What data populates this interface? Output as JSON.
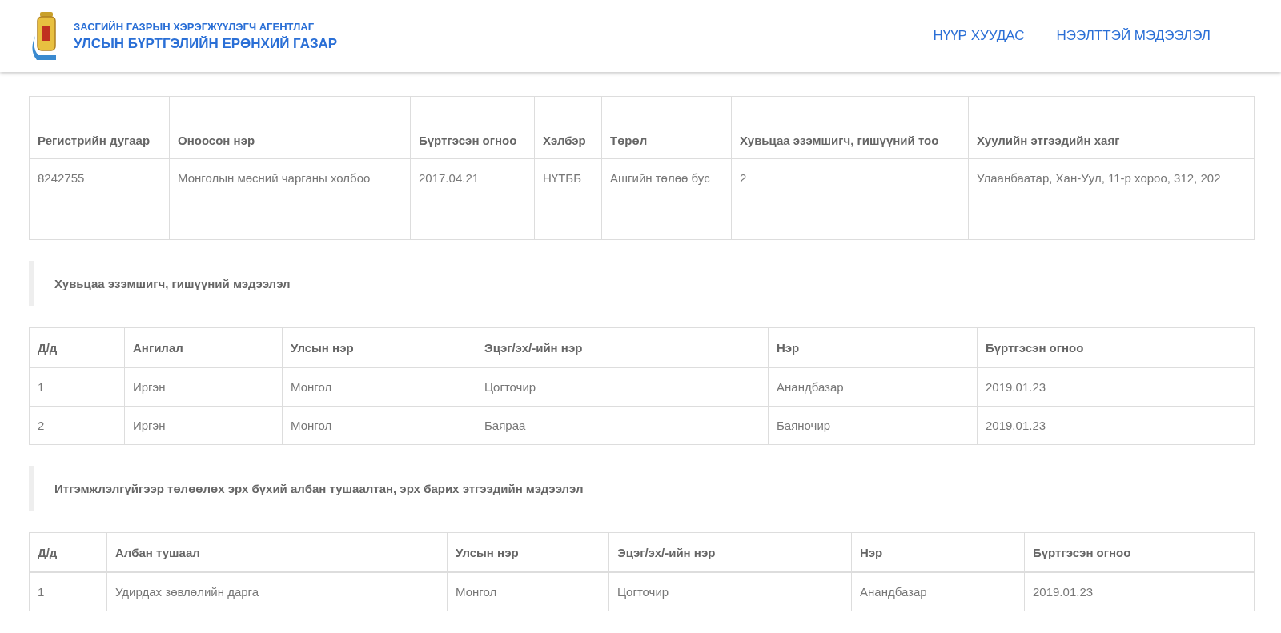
{
  "header": {
    "agency_line": "ЗАСГИЙН ГАЗРЫН ХЭРЭГЖҮҮЛЭГЧ АГЕНТЛАГ",
    "org_name": "УЛСЫН БҮРТГЭЛИЙН ЕРӨНХИЙ ГАЗАР",
    "nav": [
      "НҮҮР ХУУДАС",
      "НЭЭЛТТЭЙ МЭДЭЭЛЭЛ"
    ]
  },
  "registration_table": {
    "columns": [
      "Регистрийн дугаар",
      "Оноосон нэр",
      "Бүртгэсэн огноо",
      "Хэлбэр",
      "Төрөл",
      "Хувьцаа эзэмшигч, гишүүний тоо",
      "Хуулийн этгээдийн хаяг"
    ],
    "rows": [
      [
        "8242755",
        "Монголын мөсний чарганы холбоо",
        "2017.04.21",
        "НҮТББ",
        "Ашгийн төлөө бус",
        "2",
        "Улаанбаатар, Хан-Уул, 11-р хороо, 312, 202"
      ]
    ]
  },
  "sections": [
    {
      "title": "Хувьцаа эзэмшигч, гишүүний мэдээлэл",
      "table": {
        "columns": [
          "Д/д",
          "Ангилал",
          "Улсын нэр",
          "Эцэг/эх/-ийн нэр",
          "Нэр",
          "Бүртгэсэн огноо"
        ],
        "rows": [
          [
            "1",
            "Иргэн",
            "Монгол",
            "Цогточир",
            "Анандбазар",
            "2019.01.23"
          ],
          [
            "2",
            "Иргэн",
            "Монгол",
            "Баяраа",
            "Баяночир",
            "2019.01.23"
          ]
        ]
      }
    },
    {
      "title": "Итгэмжлэлгүйгээр төлөөлөх эрх бүхий албан тушаалтан, эрх барих этгээдийн мэдээлэл",
      "table": {
        "columns": [
          "Д/д",
          "Албан тушаал",
          "Улсын нэр",
          "Эцэг/эх/-ийн нэр",
          "Нэр",
          "Бүртгэсэн огноо"
        ],
        "rows": [
          [
            "1",
            "Удирдах зөвлөлийн дарга",
            "Монгол",
            "Цогточир",
            "Анандбазар",
            "2019.01.23"
          ]
        ]
      }
    }
  ]
}
